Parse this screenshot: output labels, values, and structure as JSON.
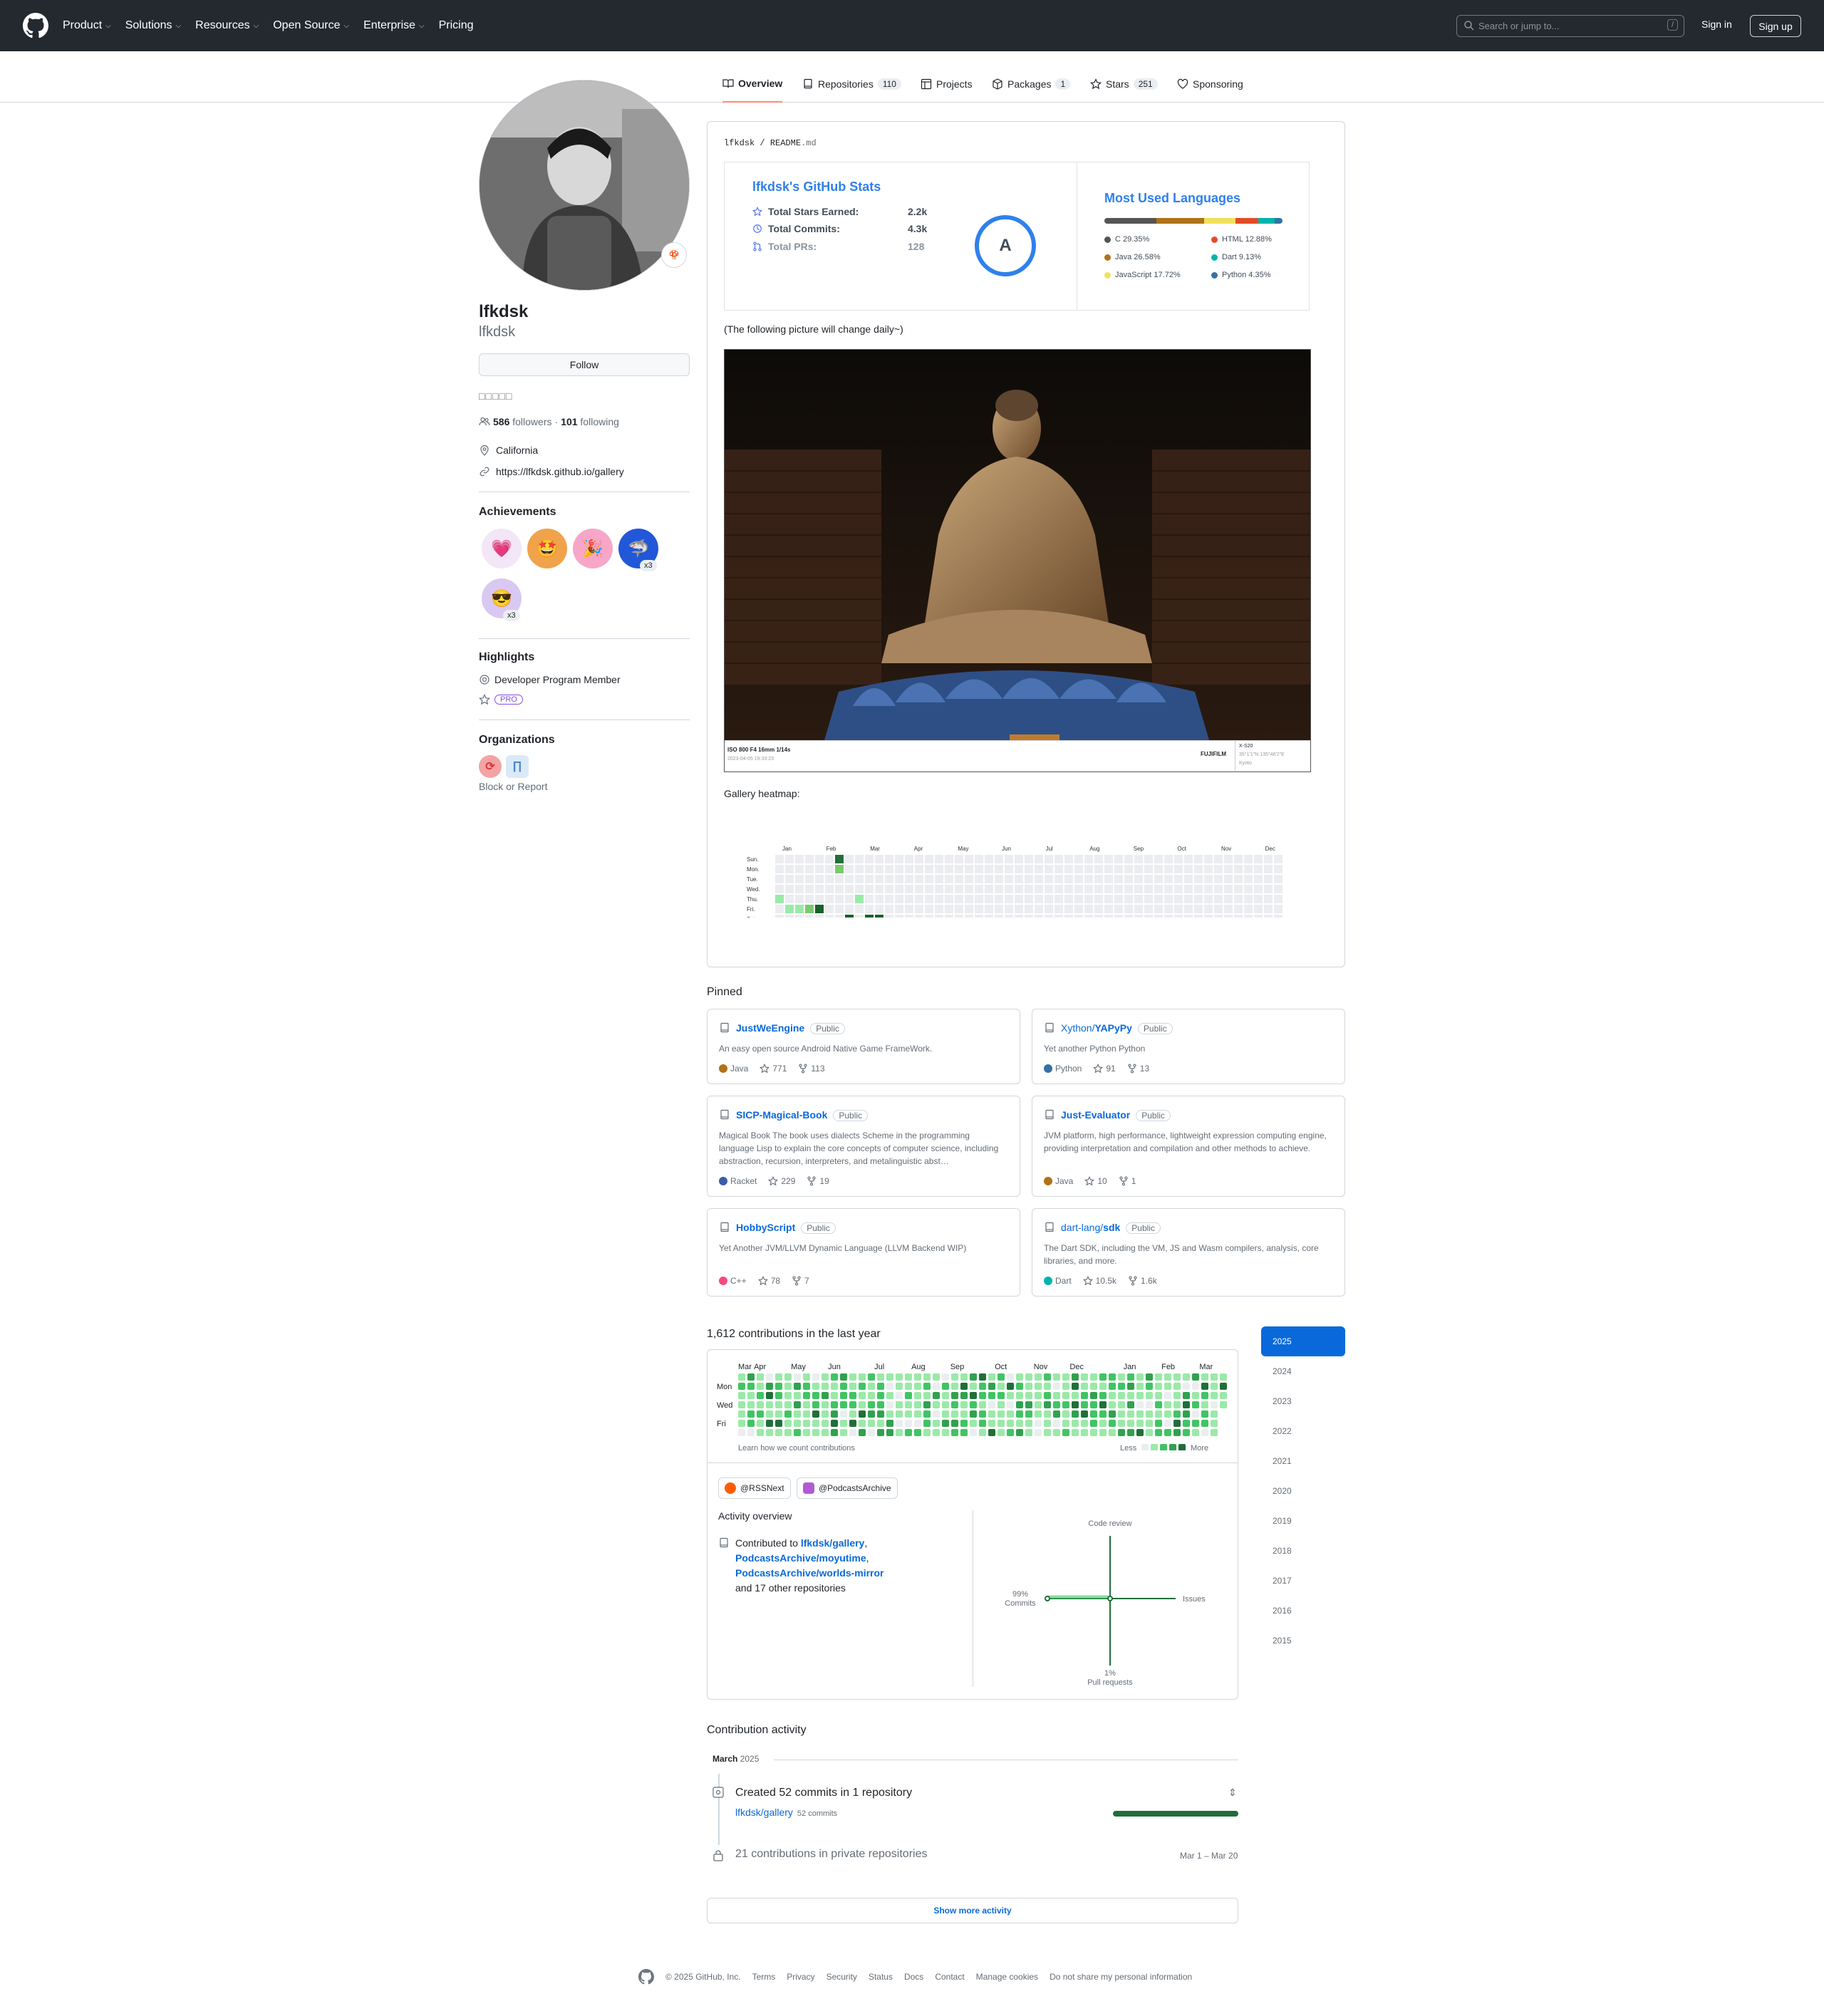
{
  "topbar": {
    "nav": [
      "Product",
      "Solutions",
      "Resources",
      "Open Source",
      "Enterprise",
      "Pricing"
    ],
    "search_placeholder": "Search or jump to...",
    "search_key": "/",
    "signin": "Sign in",
    "signup": "Sign up"
  },
  "tabs": [
    {
      "label": "Overview",
      "count": ""
    },
    {
      "label": "Repositories",
      "count": "110"
    },
    {
      "label": "Projects",
      "count": ""
    },
    {
      "label": "Packages",
      "count": "1"
    },
    {
      "label": "Stars",
      "count": "251"
    },
    {
      "label": "Sponsoring",
      "count": ""
    }
  ],
  "profile": {
    "name": "lfkdsk",
    "login": "lfkdsk",
    "follow": "Follow",
    "boxes": "□□□□□",
    "followers": "586",
    "followers_label": "followers",
    "sep": "·",
    "following": "101",
    "following_label": "following",
    "location": "California",
    "website": "https://lfkdsk.github.io/gallery"
  },
  "achievements": {
    "title": "Achievements",
    "badge_x3_a": "x3",
    "badge_x3_b": "x3"
  },
  "highlights": {
    "title": "Highlights",
    "dev": "Developer Program Member",
    "pro": "PRO"
  },
  "organizations": {
    "title": "Organizations",
    "block": "Block or Report"
  },
  "readme": {
    "path_user": "lfkdsk",
    "path_sep": "/",
    "path_file": "README",
    "path_ext": ".md",
    "stats_title": "lfkdsk's GitHub Stats",
    "stats": [
      {
        "label": "Total Stars Earned:",
        "value": "2.2k"
      },
      {
        "label": "Total Commits:",
        "value": "4.3k"
      },
      {
        "label": "Total PRs:",
        "value": "128"
      }
    ],
    "grade": "A",
    "lang_title": "Most Used Languages",
    "langs": [
      {
        "label": "C 29.35%",
        "color": "#555555",
        "pct": 29.35
      },
      {
        "label": "Java 26.58%",
        "color": "#b07219",
        "pct": 26.58
      },
      {
        "label": "JavaScript 17.72%",
        "color": "#f1e05a",
        "pct": 17.72
      },
      {
        "label": "HTML 12.88%",
        "color": "#e34c26",
        "pct": 12.88
      },
      {
        "label": "Dart 9.13%",
        "color": "#00b4ab",
        "pct": 9.13
      },
      {
        "label": "Python 4.35%",
        "color": "#3572A5",
        "pct": 4.35
      }
    ],
    "note": "(The following picture will change daily~)",
    "cap_left": "ISO 800 F4 16mm 1/14s",
    "cap_date": "2023-04-05 19:33:23",
    "cap_brand": "FUJIFILM",
    "cap_cam": "X-S20",
    "cap_coord": "35°1'1\"N 135°46'2\"E",
    "cap_loc": "Kyoto",
    "heat_title": "Gallery heatmap:",
    "heat_months": [
      "Jan",
      "Feb",
      "Mar",
      "Apr",
      "May",
      "Jun",
      "Jul",
      "Aug",
      "Sep",
      "Oct",
      "Nov",
      "Dec"
    ],
    "heat_days": [
      "Sun.",
      "Mon.",
      "Tue.",
      "Wed.",
      "Thu.",
      "Fri.",
      "Sat."
    ]
  },
  "pinned_title": "Pinned",
  "pinned": [
    {
      "owner": "",
      "name": "JustWeEngine",
      "vis": "Public",
      "desc": "An easy open source Android Native Game FrameWork.",
      "lang": "Java",
      "color": "#b07219",
      "stars": "771",
      "forks": "113"
    },
    {
      "owner": "Xython/",
      "name": "YAPyPy",
      "vis": "Public",
      "desc": "Yet another Python Python",
      "lang": "Python",
      "color": "#3572A5",
      "stars": "91",
      "forks": "13"
    },
    {
      "owner": "",
      "name": "SICP-Magical-Book",
      "vis": "Public",
      "desc": "Magical Book The book uses dialects Scheme in the programming language Lisp to explain the core concepts of computer science, including abstraction, recursion, interpreters, and metalinguistic abst…",
      "lang": "Racket",
      "color": "#3c5caa",
      "stars": "229",
      "forks": "19"
    },
    {
      "owner": "",
      "name": "Just-Evaluator",
      "vis": "Public",
      "desc": "JVM platform, high performance, lightweight expression computing engine, providing interpretation and compilation and other methods to achieve.",
      "lang": "Java",
      "color": "#b07219",
      "stars": "10",
      "forks": "1"
    },
    {
      "owner": "",
      "name": "HobbyScript",
      "vis": "Public",
      "desc": "Yet Another JVM/LLVM Dynamic Language (LLVM Backend WIP)",
      "lang": "C++",
      "color": "#f34b7d",
      "stars": "78",
      "forks": "7"
    },
    {
      "owner": "dart-lang/",
      "name": "sdk",
      "vis": "Public",
      "desc": "The Dart SDK, including the VM, JS and Wasm compilers, analysis, core libraries, and more.",
      "lang": "Dart",
      "color": "#00B4AB",
      "stars": "10.5k",
      "forks": "1.6k"
    }
  ],
  "contrib": {
    "title": "1,612 contributions in the last year",
    "months": [
      "Mar",
      "Apr",
      "May",
      "Jun",
      "Jul",
      "Aug",
      "Sep",
      "Oct",
      "Nov",
      "Dec",
      "Jan",
      "Feb",
      "Mar"
    ],
    "days": [
      "Mon",
      "Wed",
      "Fri"
    ],
    "learn": "Learn how we count contributions",
    "less": "Less",
    "more": "More",
    "orgs": [
      "@RSSNext",
      "@PodcastsArchive"
    ],
    "overview_title": "Activity overview",
    "contributed_to": "Contributed to",
    "repos": [
      "lfkdsk/gallery",
      "PodcastsArchive/moyutime",
      "PodcastsArchive/worlds-mirror"
    ],
    "others": "and 17 other repositories",
    "axis": {
      "top": "Code review",
      "right": "Issues",
      "left_pct": "99%",
      "left": "Commits",
      "bottom_pct": "1%",
      "bottom": "Pull requests"
    },
    "years": [
      "2025",
      "2024",
      "2023",
      "2022",
      "2021",
      "2020",
      "2019",
      "2018",
      "2017",
      "2016",
      "2015"
    ]
  },
  "activity": {
    "title": "Contribution activity",
    "month": "March",
    "year": "2025",
    "created": "Created 52 commits in 1 repository",
    "repo": "lfkdsk/gallery",
    "repo_count": "52 commits",
    "private": "21 contributions in private repositories",
    "private_date": "Mar 1 – Mar 20",
    "show_more": "Show more activity"
  },
  "footer": [
    "© 2025 GitHub, Inc.",
    "Terms",
    "Privacy",
    "Security",
    "Status",
    "Docs",
    "Contact",
    "Manage cookies",
    "Do not share my personal information"
  ]
}
